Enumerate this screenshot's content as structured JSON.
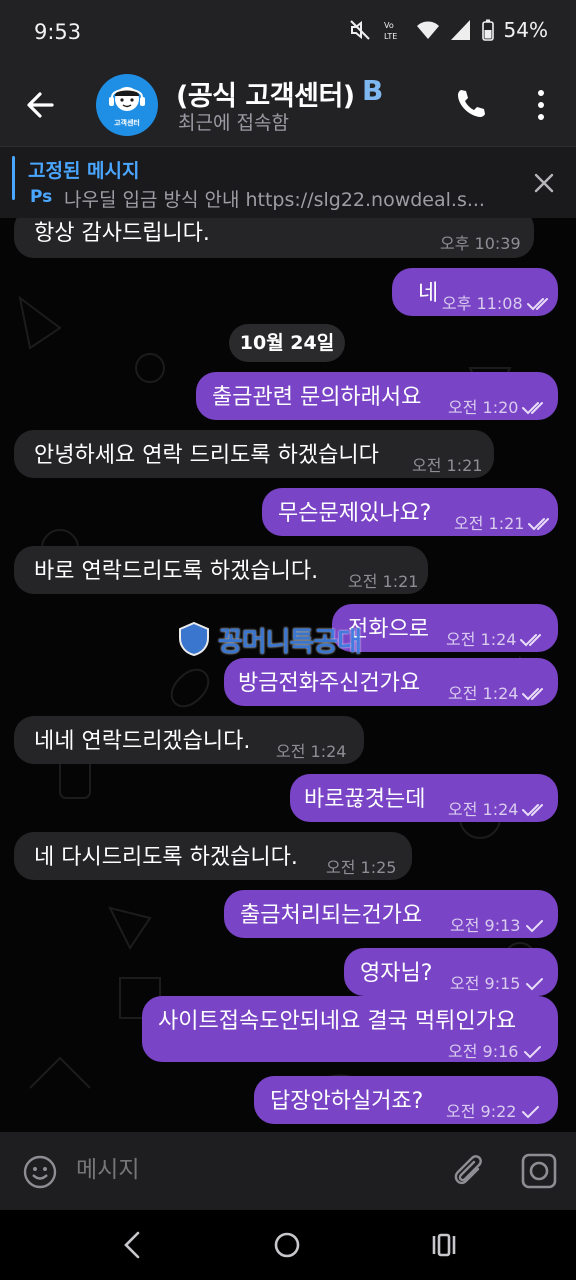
{
  "status_bar": {
    "time": "9:53",
    "network_label": "VoLTE",
    "battery_pct": "54%",
    "icons": [
      "mute-icon",
      "volte-icon",
      "wifi-icon",
      "signal-icon",
      "battery-icon"
    ]
  },
  "header": {
    "title": "(공식 고객센터)",
    "badge": "B",
    "status": "최근에 접속함",
    "avatar_text": "고객센터"
  },
  "pinned": {
    "title": "고정된 메시지",
    "tag": "Ps",
    "text": "나우딜 입금 방식 안내  https://slg22.nowdeal.s..."
  },
  "messages": [
    {
      "dir": "in",
      "text": "항상 감사드립니다.",
      "time": "오후 10:39",
      "check": ""
    },
    {
      "dir": "out",
      "text": "네",
      "time": "오후 11:08",
      "check": "double"
    },
    {
      "dir": "out",
      "text": "출금관련 문의하래서요",
      "time": "오전 1:20",
      "check": "double"
    },
    {
      "dir": "in",
      "text": "안녕하세요 연락 드리도록 하겠습니다",
      "time": "오전 1:21",
      "check": ""
    },
    {
      "dir": "out",
      "text": "무슨문제있나요?",
      "time": "오전 1:21",
      "check": "double"
    },
    {
      "dir": "in",
      "text": "바로 연락드리도록 하겠습니다.",
      "time": "오전 1:21",
      "check": ""
    },
    {
      "dir": "out",
      "text": "전화으로",
      "time": "오전 1:24",
      "check": "double"
    },
    {
      "dir": "out",
      "text": "방금전화주신건가요",
      "time": "오전 1:24",
      "check": "double"
    },
    {
      "dir": "in",
      "text": "네네 연락드리겠습니다.",
      "time": "오전 1:24",
      "check": ""
    },
    {
      "dir": "out",
      "text": "바로끊겻는데",
      "time": "오전 1:24",
      "check": "double"
    },
    {
      "dir": "in",
      "text": "네 다시드리도록 하겠습니다.",
      "time": "오전 1:25",
      "check": ""
    },
    {
      "dir": "out",
      "text": "출금처리되는건가요",
      "time": "오전 9:13",
      "check": "single"
    },
    {
      "dir": "out",
      "text": "영자님?",
      "time": "오전 9:15",
      "check": "single"
    },
    {
      "dir": "out",
      "text": "사이트접속도안되네요 결국 먹튀인가요",
      "time": "오전 9:16",
      "check": "single"
    },
    {
      "dir": "out",
      "text": "답장안하실거죠?",
      "time": "오전 9:22",
      "check": "single"
    }
  ],
  "date_separator": "10월 24일",
  "watermark": "꽁머니특공대",
  "input": {
    "placeholder": "메시지"
  },
  "colors": {
    "outgoing_bubble": "#7a44c6",
    "incoming_bubble": "#252527",
    "accent": "#4aa6ff",
    "header_bg": "#222225"
  }
}
